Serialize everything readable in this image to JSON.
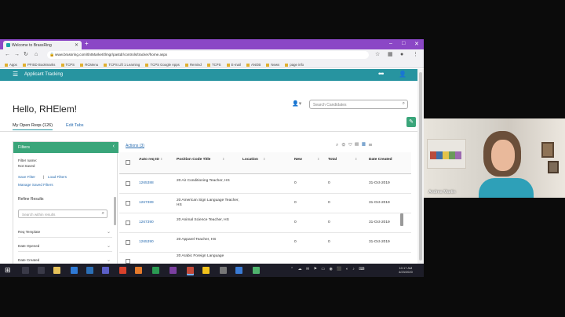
{
  "browser": {
    "tab_title": "Welcome to BrassRing",
    "new_tab": "+",
    "url": "www.brassring.com/tlntMarket/tlmgr/pastdr/controls/tracker/home.aspx",
    "bookmarks": [
      "Apps",
      "PFISD Bookmarks",
      "TCPS",
      "RCMenu",
      "TCPS Lift 1 Learning",
      "TCPS Google Apps",
      "Remind",
      "TCPS",
      "E-mail",
      "ANOB",
      "News",
      "page info"
    ]
  },
  "app": {
    "title": "Applicant Tracking",
    "greeting": "Hello, RHElem!",
    "candidate_search_placeholder": "Search Candidates",
    "tabs": [
      "My Open Reqs (126)",
      "Edit Tabs"
    ]
  },
  "filters": {
    "header": "Filters",
    "filter_name_label": "Filter name:",
    "filter_name_value": "Not Saved",
    "save_filter": "Save Filter",
    "divider": "|",
    "load_filters": "Load Filters",
    "manage_saved": "Manage Saved Filters",
    "refine_label": "Refine Results",
    "refine_placeholder": "Search within results",
    "sections": [
      "Req Template",
      "Date Opened",
      "Date Created"
    ]
  },
  "table": {
    "actions_label": "Actions (3)",
    "headers": [
      "Auto req ID",
      "Position Code Title",
      "Location",
      "New",
      "Total",
      "Date Created"
    ],
    "rows": [
      {
        "id": "1265388",
        "title": "20 Air Conditioning Teacher, HS",
        "location": "",
        "new": "0",
        "total": "0",
        "date": "31-Oct-2019"
      },
      {
        "id": "1267389",
        "title": "20 American Sign Language Teacher, HS",
        "location": "",
        "new": "0",
        "total": "0",
        "date": "31-Oct-2019"
      },
      {
        "id": "1267390",
        "title": "20 Animal Science Teacher, HS",
        "location": "",
        "new": "0",
        "total": "0",
        "date": "31-Oct-2019"
      },
      {
        "id": "1265390",
        "title": "20 Apparel Teacher, HS",
        "location": "",
        "new": "0",
        "total": "0",
        "date": "31-Oct-2019"
      },
      {
        "id": "",
        "title": "20 Arabic Foreign Language",
        "location": "",
        "new": "",
        "total": "",
        "date": ""
      }
    ]
  },
  "taskbar": {
    "clock_time": "10:17 AM",
    "clock_date": "4/23/2020"
  },
  "webcam": {
    "name": "Andrea Martin"
  },
  "colors": {
    "browser_purple": "#8b47c6",
    "app_teal": "#2794a0",
    "filter_green": "#3aa57a"
  }
}
